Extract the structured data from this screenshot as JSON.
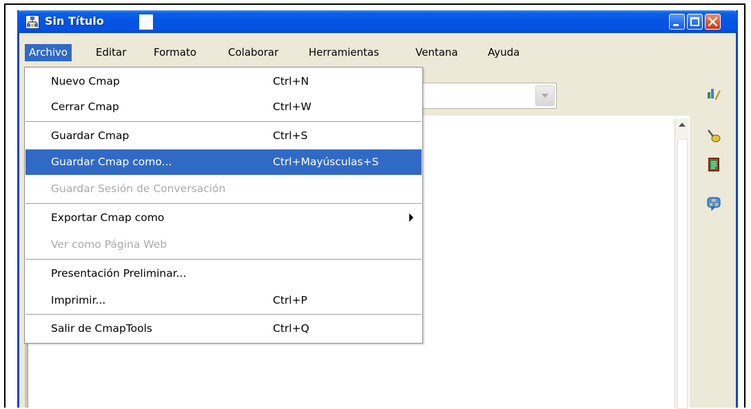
{
  "window": {
    "title": "Sin Título",
    "icon": "cmap-app-icon",
    "controls": [
      "minimize-icon",
      "maximize-icon",
      "close-icon"
    ]
  },
  "menubar": {
    "items": [
      "Archivo",
      "Editar",
      "Formato",
      "Colaborar",
      "Herramientas",
      "Ventana",
      "Ayuda"
    ],
    "active": "Archivo"
  },
  "archivo_menu": {
    "items": [
      {
        "label": "Nuevo Cmap",
        "shortcut": "Ctrl+N"
      },
      {
        "label": "Cerrar Cmap",
        "shortcut": "Ctrl+W"
      },
      {
        "label": "Guardar Cmap",
        "shortcut": "Ctrl+S"
      },
      {
        "label": "Guardar Cmap como...",
        "shortcut": "Ctrl+Mayúsculas+S",
        "selected": true
      },
      {
        "label": "Guardar Sesión de Conversación",
        "shortcut": "",
        "disabled": true
      },
      {
        "label": "Exportar Cmap como",
        "shortcut": "",
        "submenu": true
      },
      {
        "label": "Ver como Página Web",
        "shortcut": "",
        "disabled": true
      },
      {
        "label": "Presentación Preliminar...",
        "shortcut": ""
      },
      {
        "label": "Imprimir...",
        "shortcut": "Ctrl+P"
      },
      {
        "label": "Salir de CmapTools",
        "shortcut": "Ctrl+Q"
      }
    ]
  },
  "side_toolbar": {
    "icons": [
      "edit-styles-icon",
      "brush-icon",
      "document-icon",
      "chat-icon"
    ]
  },
  "colors": {
    "titlebar": "#0554e3",
    "selection": "#316ac5",
    "menu_bg": "#ece9d8",
    "disabled_text": "#a9a9a9"
  }
}
